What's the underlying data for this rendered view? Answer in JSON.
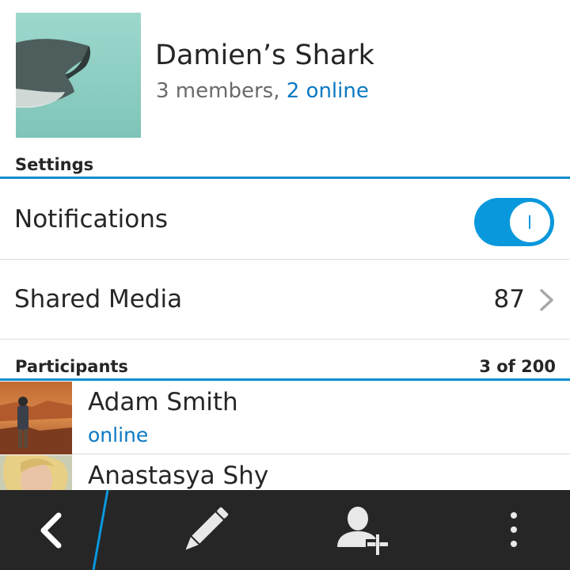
{
  "group": {
    "name": "Damien’s Shark",
    "members_text": "3 members,",
    "online_text": "2 online"
  },
  "settings": {
    "header": "Settings",
    "notifications_label": "Notifications",
    "notifications_on": true,
    "shared_media_label": "Shared Media",
    "shared_media_count": "87"
  },
  "participants": {
    "header": "Participants",
    "count_text": "3 of 200",
    "items": [
      {
        "name": "Adam Smith",
        "status": "online"
      },
      {
        "name": "Anastasya Shy",
        "status": ""
      }
    ]
  },
  "action_bar": {
    "icons": [
      "back-icon",
      "pencil-icon",
      "add-contact-icon",
      "overflow-menu-icon"
    ]
  },
  "colors": {
    "accent": "#0a8ed0",
    "online_text": "#0a79c2",
    "toggle_on": "#0a98dd",
    "action_bar_bg": "#262626"
  }
}
